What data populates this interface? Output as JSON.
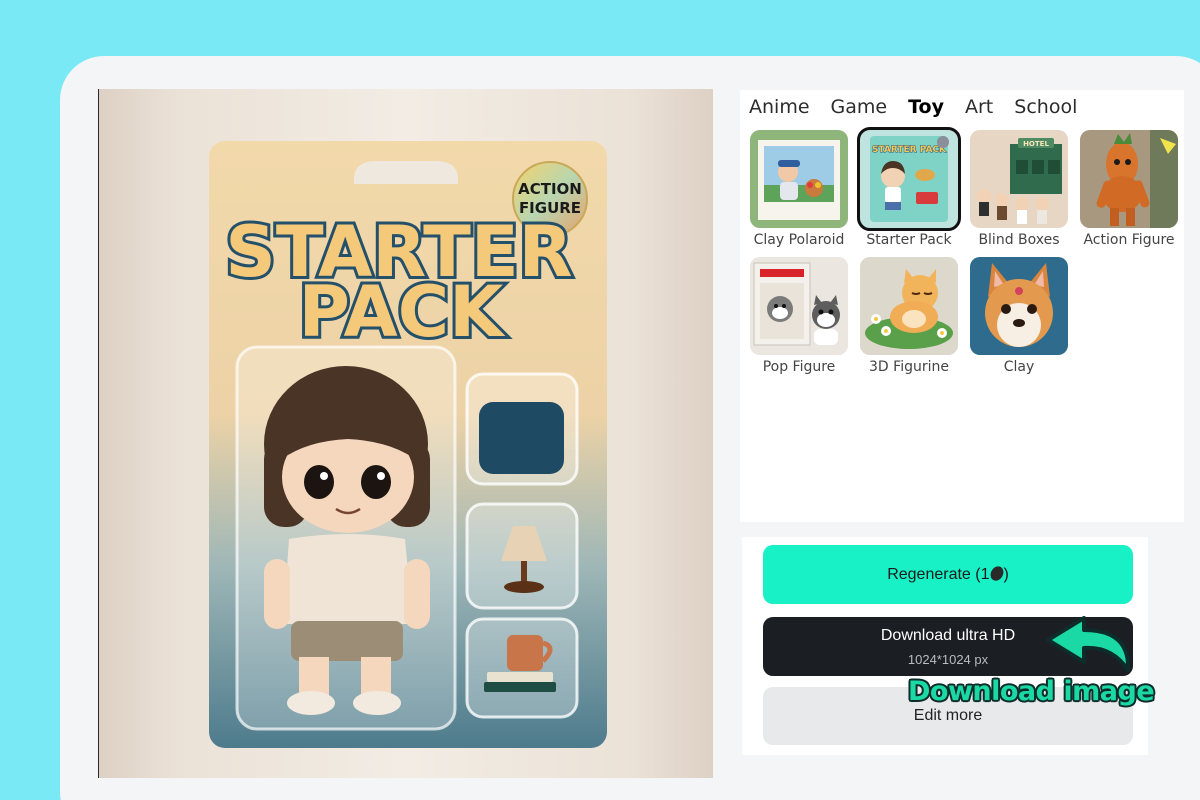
{
  "preview": {
    "package_title_line1": "STARTER",
    "package_title_line2": "PACK",
    "badge_line1": "ACTION",
    "badge_line2": "FIGURE"
  },
  "tabs": [
    {
      "label": "Anime",
      "active": false
    },
    {
      "label": "Game",
      "active": false
    },
    {
      "label": "Toy",
      "active": true
    },
    {
      "label": "Art",
      "active": false
    },
    {
      "label": "School",
      "active": false
    }
  ],
  "styles": [
    {
      "label": "Clay Polaroid",
      "icon": "clay-polaroid-thumbnail",
      "selected": false
    },
    {
      "label": "Starter Pack",
      "icon": "starter-pack-thumbnail",
      "selected": true
    },
    {
      "label": "Blind Boxes",
      "icon": "blind-boxes-thumbnail",
      "selected": false
    },
    {
      "label": "Action Figure",
      "icon": "action-figure-thumbnail",
      "selected": false
    },
    {
      "label": "Pop Figure",
      "icon": "pop-figure-thumbnail",
      "selected": false
    },
    {
      "label": "3D Figurine",
      "icon": "3d-figurine-thumbnail",
      "selected": false
    },
    {
      "label": "Clay",
      "icon": "clay-thumbnail",
      "selected": false
    }
  ],
  "thumb_texts": {
    "starter_pack": "STARTER PACK",
    "hotel": "HOTEL"
  },
  "actions": {
    "regenerate_label": "Regenerate (1",
    "regenerate_suffix": ")",
    "download_label": "Download ultra HD",
    "download_sub": "1024*1024 px",
    "edit_label": "Edit more"
  },
  "annotation": {
    "text": "Download image"
  },
  "colors": {
    "page_bg": "#78e9f5",
    "accent": "#18f0c5",
    "download_bg": "#1b1e22",
    "annotation_text": "#1bd9a5"
  }
}
